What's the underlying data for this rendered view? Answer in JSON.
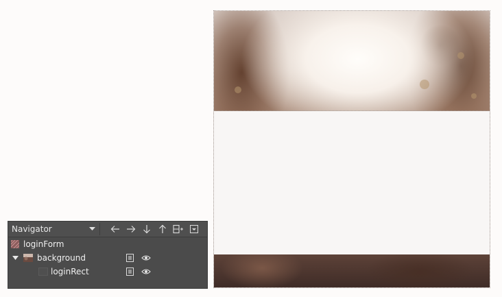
{
  "navigator": {
    "title": "Navigator",
    "toolbar": [
      "arrow-left-icon",
      "arrow-right-icon",
      "arrow-down-icon",
      "arrow-up-icon",
      "add-to-group-icon",
      "filter-icon"
    ],
    "tree": [
      {
        "label": "loginForm",
        "icon": "form-icon",
        "level": 0
      },
      {
        "label": "background",
        "icon": "image-icon",
        "level": 0,
        "expanded": true
      },
      {
        "label": "loginRect",
        "icon": "rectangle-icon",
        "level": 1
      }
    ]
  },
  "colors": {
    "panel_bg": "#4b4b4b",
    "canvas_bg": "#f8f6f5",
    "page_bg": "#fdfbfa"
  }
}
